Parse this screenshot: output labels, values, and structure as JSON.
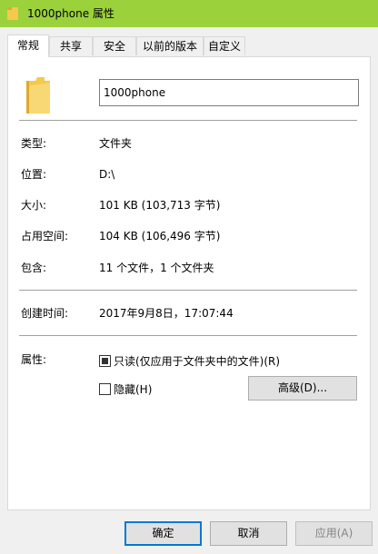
{
  "window": {
    "title": "1000phone 属性"
  },
  "tabs": [
    {
      "label": "常规"
    },
    {
      "label": "共享"
    },
    {
      "label": "安全"
    },
    {
      "label": "以前的版本"
    },
    {
      "label": "自定义"
    }
  ],
  "general": {
    "name_value": "1000phone",
    "type_label": "类型:",
    "type_value": "文件夹",
    "location_label": "位置:",
    "location_value": "D:\\",
    "size_label": "大小:",
    "size_value": "101 KB (103,713 字节)",
    "disk_label": "占用空间:",
    "disk_value": "104 KB (106,496 字节)",
    "contains_label": "包含:",
    "contains_value": "11 个文件，1 个文件夹",
    "created_label": "创建时间:",
    "created_value": "2017年9月8日，17:07:44",
    "attributes_label": "属性:",
    "readonly_label": "只读(仅应用于文件夹中的文件)(R)",
    "readonly_checked": true,
    "hidden_label": "隐藏(H)",
    "hidden_checked": false,
    "advanced_label": "高级(D)..."
  },
  "footer": {
    "ok_label": "确定",
    "cancel_label": "取消",
    "apply_label": "应用(A)"
  },
  "colors": {
    "titlebar": "#9bd13b",
    "folder": "#f5c94c",
    "accent": "#0078d7"
  }
}
